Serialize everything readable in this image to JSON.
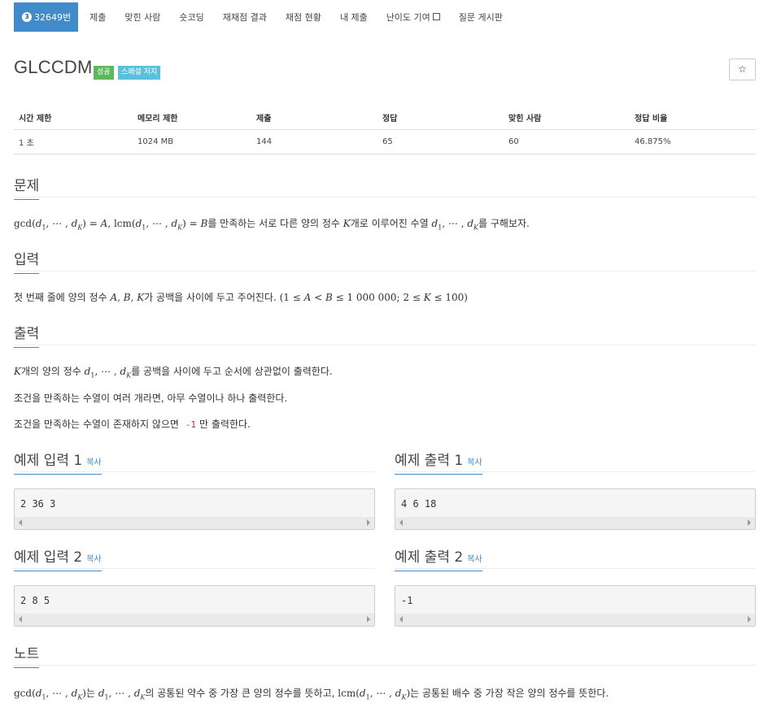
{
  "nav": {
    "problem_badge": "3",
    "problem_id": "32649번",
    "tabs": [
      "제출",
      "맞힌 사람",
      "숏코딩",
      "재채점 결과",
      "채점 현황",
      "내 제출",
      "난이도 기여",
      "질문 게시판"
    ]
  },
  "problem": {
    "title": "GLCCDM",
    "label_success": "성공",
    "label_special": "스페셜 저지",
    "star": "☆"
  },
  "stats": {
    "headers": [
      "시간 제한",
      "메모리 제한",
      "제출",
      "정답",
      "맞힌 사람",
      "정답 비율"
    ],
    "values": [
      "1 초",
      "1024 MB",
      "144",
      "65",
      "60",
      "46.875%"
    ]
  },
  "sections": {
    "problem": "문제",
    "input": "입력",
    "output": "출력",
    "note": "노트"
  },
  "text": {
    "problem_ko_1": "를 만족하는 서로 다른 양의 정수",
    "problem_ko_2": "개로 이루어진 수열",
    "problem_ko_3": "를 구해보자.",
    "input_ko_1": "첫 번째 줄에 양의 정수",
    "input_ko_2": "가 공백을 사이에 두고 주어진다.",
    "output_ko_1": "개의 양의 정수",
    "output_ko_2": "를 공백을 사이에 두고 순서에 상관없이 출력한다.",
    "output_line2": "조건을 만족하는 수열이 여러 개라면, 아무 수열이나 하나 출력한다.",
    "output_line3_a": "조건을 만족하는 수열이 존재하지 않으면",
    "output_line3_code": "-1",
    "output_line3_b": "만 출력한다.",
    "note_ko_1": "는",
    "note_ko_2": "의 공통된 약수 중 가장 큰 양의 정수를 뜻하고,",
    "note_ko_3": "는 공통된 배수 중 가장 작은 양의 정수를 뜻한다."
  },
  "samples": {
    "copy_label": "복사",
    "in1_title": "예제 입력 1",
    "out1_title": "예제 출력 1",
    "in2_title": "예제 입력 2",
    "out2_title": "예제 출력 2",
    "in1": "2 36 3",
    "out1": "4 6 18",
    "in2": "2 8 5",
    "out2": "-1"
  }
}
